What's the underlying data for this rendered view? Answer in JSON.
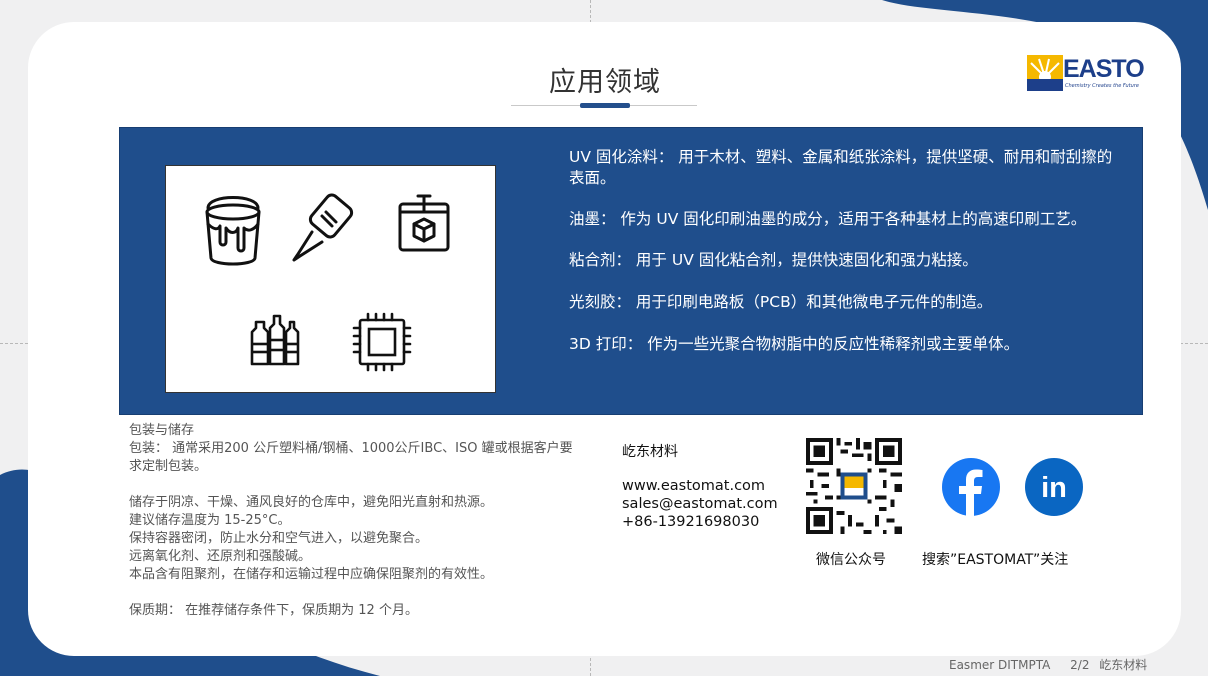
{
  "slide": {
    "title": "应用领域"
  },
  "logo": {
    "brand": "EASTO",
    "slogan": "Chemistry Creates the Future"
  },
  "applications": [
    {
      "text": "UV 固化涂料： 用于木材、塑料、金属和纸张涂料，提供坚硬、耐用和耐刮擦的表面。"
    },
    {
      "text": "油墨： 作为 UV 固化印刷油墨的成分，适用于各种基材上的高速印刷工艺。"
    },
    {
      "text": "粘合剂： 用于 UV 固化粘合剂，提供快速固化和强力粘接。"
    },
    {
      "text": "光刻胶： 用于印刷电路板（PCB）和其他微电子元件的制造。"
    },
    {
      "text": "3D 打印： 作为一些光聚合物树脂中的反应性稀释剂或主要单体。"
    }
  ],
  "icons": [
    "paint-bucket-icon",
    "glue-bottle-icon",
    "3d-printer-icon",
    "ink-bottles-icon",
    "chip-icon"
  ],
  "storage": {
    "heading": "包装与储存",
    "packaging": "包装： 通常采用200 公斤塑料桶/钢桶、1000公斤IBC、ISO 罐或根据客户要求定制包装。",
    "lines": [
      "储存于阴凉、干燥、通风良好的仓库中，避免阳光直射和热源。",
      "建议储存温度为 15-25°C。",
      "保持容器密闭，防止水分和空气进入，以避免聚合。",
      "远离氧化剂、还原剂和强酸碱。",
      "本品含有阻聚剂，在储存和运输过程中应确保阻聚剂的有效性。"
    ],
    "shelf_life": "保质期： 在推荐储存条件下，保质期为 12 个月。"
  },
  "contact": {
    "company": "屹东材料",
    "website": "www.eastomat.com",
    "email": "sales@eastomat.com",
    "phone": "+86-13921698030"
  },
  "social": {
    "qr_label": "微信公众号",
    "search_label": "搜索”EASTOMAT”关注"
  },
  "footer": {
    "product": "Easmer DITMPTA",
    "page": "2/2",
    "company": "屹东材料"
  },
  "colors": {
    "primary_blue": "#1f4e8c",
    "facebook": "#1877f2",
    "linkedin": "#0a66c2",
    "logo_yellow": "#f5b800"
  }
}
